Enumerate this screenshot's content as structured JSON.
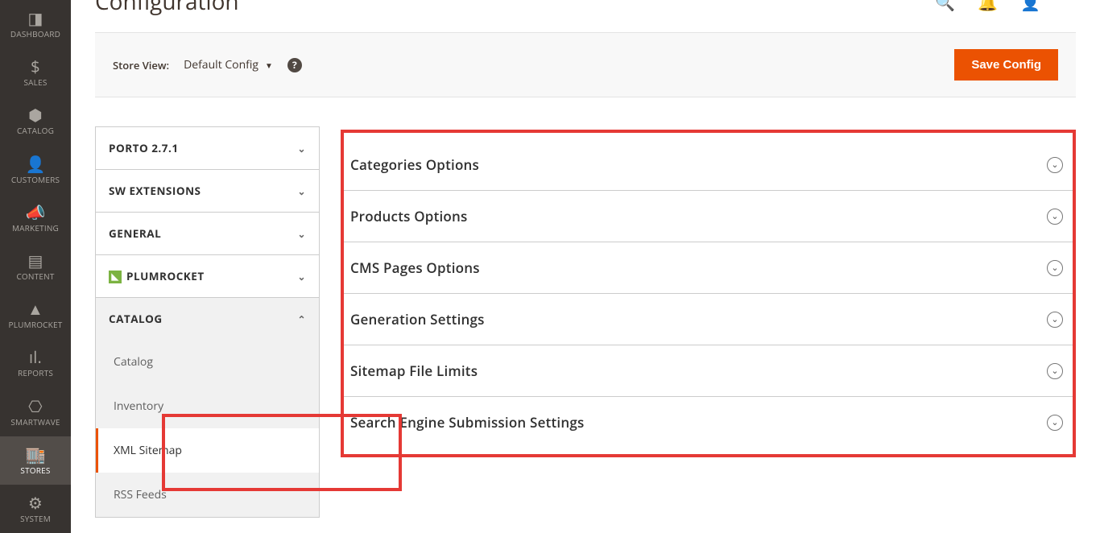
{
  "page": {
    "title": "Configuration"
  },
  "sidebar": {
    "items": [
      {
        "label": "DASHBOARD",
        "icon": "◨"
      },
      {
        "label": "SALES",
        "icon": "$"
      },
      {
        "label": "CATALOG",
        "icon": "⬢"
      },
      {
        "label": "CUSTOMERS",
        "icon": "👤"
      },
      {
        "label": "MARKETING",
        "icon": "📣"
      },
      {
        "label": "CONTENT",
        "icon": "▤"
      },
      {
        "label": "PLUMROCKET",
        "icon": "▲"
      },
      {
        "label": "REPORTS",
        "icon": "ıl."
      },
      {
        "label": "SMARTWAVE",
        "icon": "⎔"
      },
      {
        "label": "STORES",
        "icon": "🏬"
      },
      {
        "label": "SYSTEM",
        "icon": "⚙"
      }
    ],
    "active_index": 9
  },
  "store_bar": {
    "label": "Store View:",
    "selected": "Default Config",
    "save_label": "Save Config"
  },
  "config_nav": {
    "groups": [
      {
        "label": "PORTO 2.7.1",
        "icon": null,
        "expanded": false,
        "sub": []
      },
      {
        "label": "SW EXTENSIONS",
        "icon": null,
        "expanded": false,
        "sub": []
      },
      {
        "label": "GENERAL",
        "icon": null,
        "expanded": false,
        "sub": []
      },
      {
        "label": "PLUMROCKET",
        "icon": "plum",
        "expanded": false,
        "sub": []
      },
      {
        "label": "CATALOG",
        "icon": null,
        "expanded": true,
        "sub": [
          {
            "label": "Catalog",
            "active": false
          },
          {
            "label": "Inventory",
            "active": false
          },
          {
            "label": "XML Sitemap",
            "active": true
          },
          {
            "label": "RSS Feeds",
            "active": false
          }
        ]
      }
    ]
  },
  "sections": [
    {
      "title": "Categories Options"
    },
    {
      "title": "Products Options"
    },
    {
      "title": "CMS Pages Options"
    },
    {
      "title": "Generation Settings"
    },
    {
      "title": "Sitemap File Limits"
    },
    {
      "title": "Search Engine Submission Settings"
    }
  ]
}
